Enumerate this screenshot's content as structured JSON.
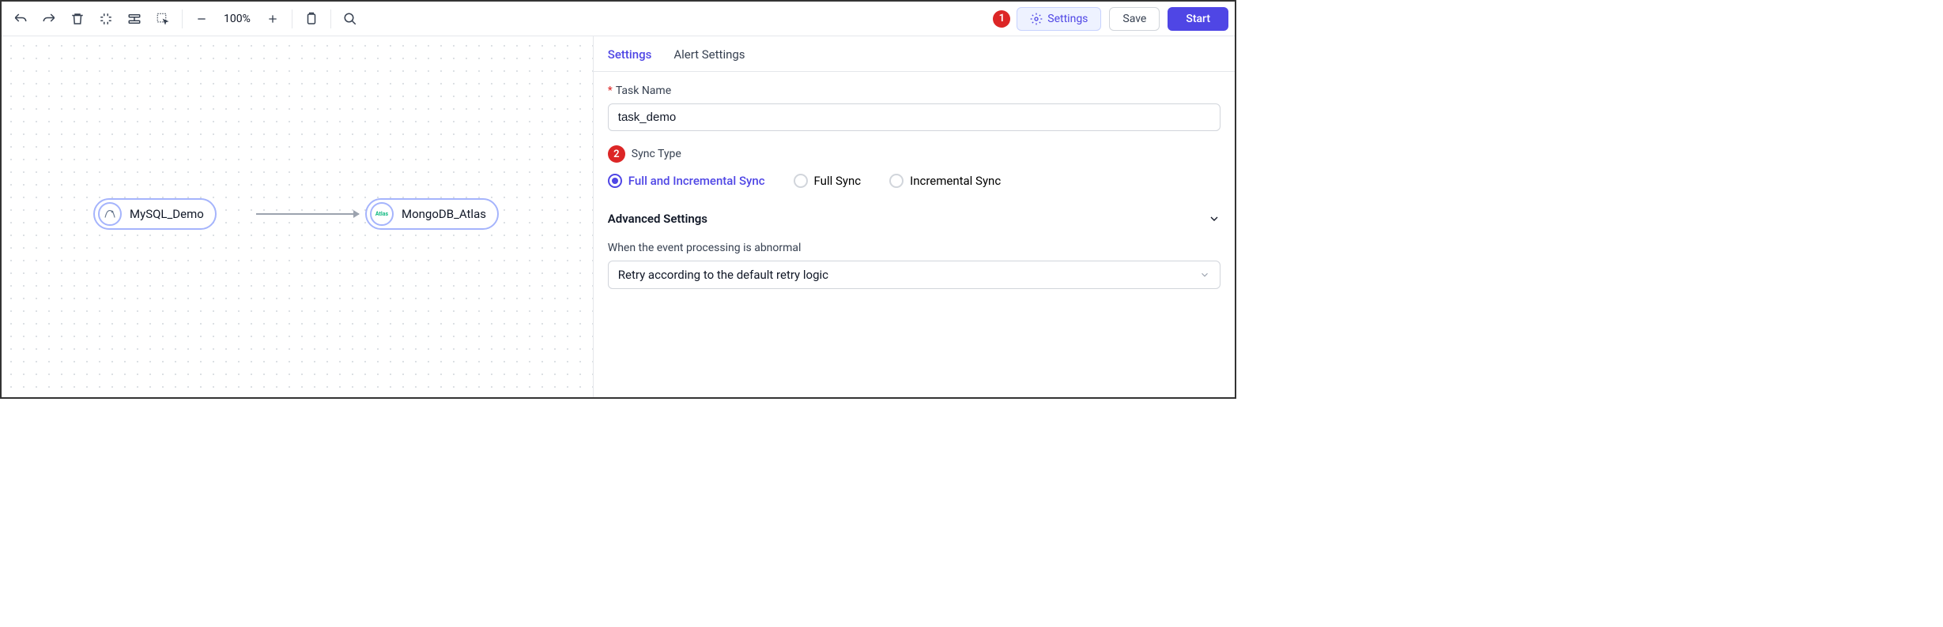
{
  "toolbar": {
    "zoom": "100%",
    "settings_label": "Settings",
    "save_label": "Save",
    "start_label": "Start"
  },
  "annotations": {
    "badge1": "1",
    "badge2": "2"
  },
  "canvas": {
    "node1": {
      "label": "MySQL_Demo",
      "icon": "🐬"
    },
    "node2": {
      "label": "MongoDB_Atlas",
      "icon_text": "Atlas"
    }
  },
  "panel": {
    "tabs": {
      "settings": "Settings",
      "alert": "Alert Settings"
    },
    "task_name_label": "Task Name",
    "task_name_value": "task_demo",
    "sync_type_label": "Sync Type",
    "sync_options": {
      "full_inc": "Full and Incremental Sync",
      "full": "Full Sync",
      "inc": "Incremental Sync"
    },
    "advanced_label": "Advanced Settings",
    "abnormal_label": "When the event processing is abnormal",
    "abnormal_value": "Retry according to the default retry logic"
  }
}
